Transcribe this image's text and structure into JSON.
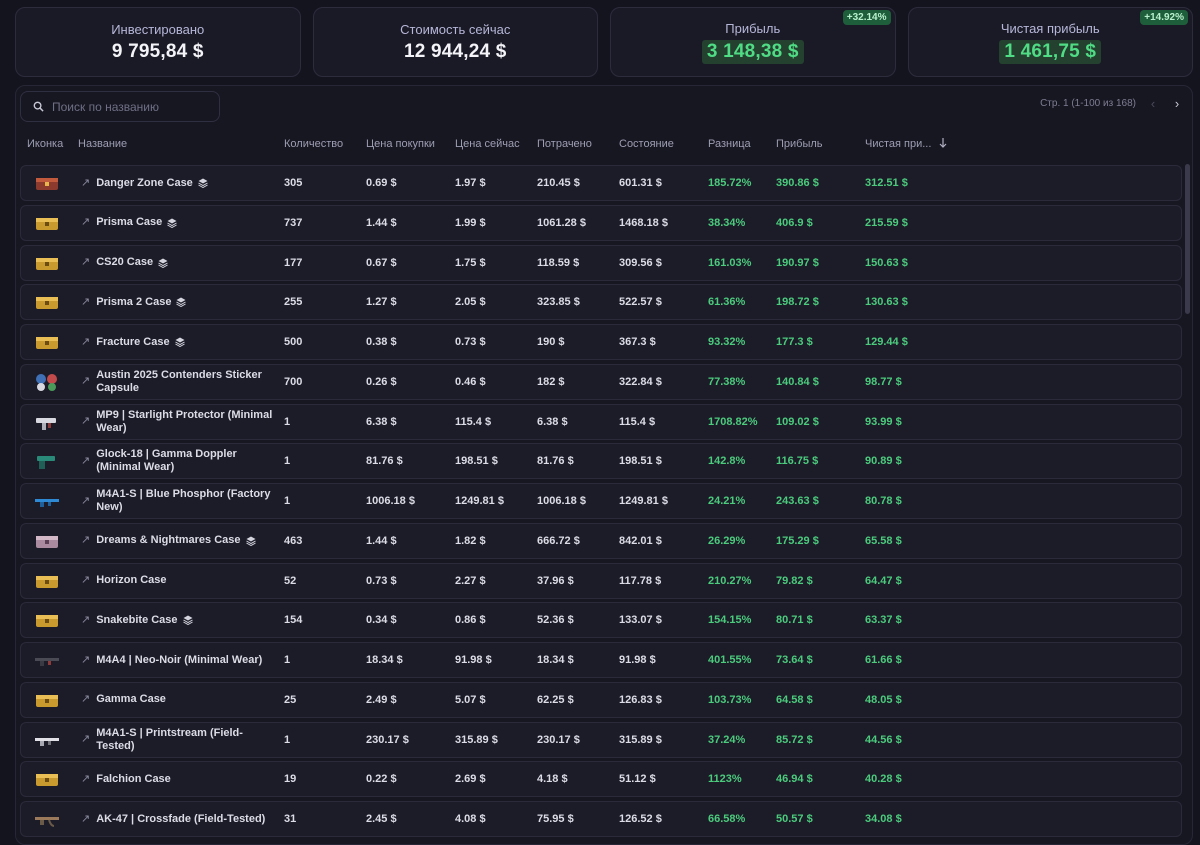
{
  "summary": [
    {
      "label": "Инвестировано",
      "value": "9 795,84 $",
      "badge": null,
      "highlight": false
    },
    {
      "label": "Стоимость сейчас",
      "value": "12 944,24 $",
      "badge": null,
      "highlight": false
    },
    {
      "label": "Прибыль",
      "value": "3 148,38 $",
      "badge": "+32.14%",
      "highlight": true
    },
    {
      "label": "Чистая прибыль",
      "value": "1 461,75 $",
      "badge": "+14.92%",
      "highlight": true
    }
  ],
  "search": {
    "placeholder": "Поиск по названию"
  },
  "pagination": {
    "text": "Стр. 1 (1-100 из 168)"
  },
  "columns": [
    "Иконка",
    "Название",
    "Количество",
    "Цена покупки",
    "Цена сейчас",
    "Потрачено",
    "Состояние",
    "Разница",
    "Прибыль",
    "Чистая при..."
  ],
  "colors": {
    "positive": "#4bcb7c",
    "case_gold": "#d6a93a",
    "background": "#14141f"
  },
  "rows": [
    {
      "name": "Danger Zone Case",
      "stack": true,
      "icon": "case-red-icon",
      "qty": "305",
      "buy": "0.69 $",
      "now": "1.97 $",
      "spent": "210.45 $",
      "value": "601.31 $",
      "diff": "185.72%",
      "profit": "390.86 $",
      "net": "312.51 $"
    },
    {
      "name": "Prisma Case",
      "stack": true,
      "icon": "case-gold-icon",
      "qty": "737",
      "buy": "1.44 $",
      "now": "1.99 $",
      "spent": "1061.28 $",
      "value": "1468.18 $",
      "diff": "38.34%",
      "profit": "406.9 $",
      "net": "215.59 $"
    },
    {
      "name": "CS20 Case",
      "stack": true,
      "icon": "case-gold-icon",
      "qty": "177",
      "buy": "0.67 $",
      "now": "1.75 $",
      "spent": "118.59 $",
      "value": "309.56 $",
      "diff": "161.03%",
      "profit": "190.97 $",
      "net": "150.63 $"
    },
    {
      "name": "Prisma 2 Case",
      "stack": true,
      "icon": "case-gold-icon",
      "qty": "255",
      "buy": "1.27 $",
      "now": "2.05 $",
      "spent": "323.85 $",
      "value": "522.57 $",
      "diff": "61.36%",
      "profit": "198.72 $",
      "net": "130.63 $"
    },
    {
      "name": "Fracture Case",
      "stack": true,
      "icon": "case-gold-icon",
      "qty": "500",
      "buy": "0.38 $",
      "now": "0.73 $",
      "spent": "190 $",
      "value": "367.3 $",
      "diff": "93.32%",
      "profit": "177.3 $",
      "net": "129.44 $"
    },
    {
      "name": "Austin 2025 Contenders Sticker Capsule",
      "stack": false,
      "icon": "sticker-capsule-icon",
      "qty": "700",
      "buy": "0.26 $",
      "now": "0.46 $",
      "spent": "182 $",
      "value": "322.84 $",
      "diff": "77.38%",
      "profit": "140.84 $",
      "net": "98.77 $"
    },
    {
      "name": "MP9 | Starlight Protector (Minimal Wear)",
      "stack": false,
      "icon": "smg-icon",
      "qty": "1",
      "buy": "6.38 $",
      "now": "115.4 $",
      "spent": "6.38 $",
      "value": "115.4 $",
      "diff": "1708.82%",
      "profit": "109.02 $",
      "net": "93.99 $"
    },
    {
      "name": "Glock-18 | Gamma Doppler (Minimal Wear)",
      "stack": false,
      "icon": "pistol-icon",
      "qty": "1",
      "buy": "81.76 $",
      "now": "198.51 $",
      "spent": "81.76 $",
      "value": "198.51 $",
      "diff": "142.8%",
      "profit": "116.75 $",
      "net": "90.89 $"
    },
    {
      "name": "M4A1-S | Blue Phosphor (Factory New)",
      "stack": false,
      "icon": "rifle-blue-icon",
      "qty": "1",
      "buy": "1006.18 $",
      "now": "1249.81 $",
      "spent": "1006.18 $",
      "value": "1249.81 $",
      "diff": "24.21%",
      "profit": "243.63 $",
      "net": "80.78 $"
    },
    {
      "name": "Dreams & Nightmares Case",
      "stack": true,
      "icon": "case-pink-icon",
      "qty": "463",
      "buy": "1.44 $",
      "now": "1.82 $",
      "spent": "666.72 $",
      "value": "842.01 $",
      "diff": "26.29%",
      "profit": "175.29 $",
      "net": "65.58 $"
    },
    {
      "name": "Horizon Case",
      "stack": false,
      "icon": "case-gold-icon",
      "qty": "52",
      "buy": "0.73 $",
      "now": "2.27 $",
      "spent": "37.96 $",
      "value": "117.78 $",
      "diff": "210.27%",
      "profit": "79.82 $",
      "net": "64.47 $"
    },
    {
      "name": "Snakebite Case",
      "stack": true,
      "icon": "case-gold-icon",
      "qty": "154",
      "buy": "0.34 $",
      "now": "0.86 $",
      "spent": "52.36 $",
      "value": "133.07 $",
      "diff": "154.15%",
      "profit": "80.71 $",
      "net": "63.37 $"
    },
    {
      "name": "M4A4 | Neo-Noir (Minimal Wear)",
      "stack": false,
      "icon": "rifle-dark-icon",
      "qty": "1",
      "buy": "18.34 $",
      "now": "91.98 $",
      "spent": "18.34 $",
      "value": "91.98 $",
      "diff": "401.55%",
      "profit": "73.64 $",
      "net": "61.66 $"
    },
    {
      "name": "Gamma Case",
      "stack": false,
      "icon": "case-gold-icon",
      "qty": "25",
      "buy": "2.49 $",
      "now": "5.07 $",
      "spent": "62.25 $",
      "value": "126.83 $",
      "diff": "103.73%",
      "profit": "64.58 $",
      "net": "48.05 $"
    },
    {
      "name": "M4A1-S | Printstream (Field-Tested)",
      "stack": false,
      "icon": "rifle-white-icon",
      "qty": "1",
      "buy": "230.17 $",
      "now": "315.89 $",
      "spent": "230.17 $",
      "value": "315.89 $",
      "diff": "37.24%",
      "profit": "85.72 $",
      "net": "44.56 $"
    },
    {
      "name": "Falchion Case",
      "stack": false,
      "icon": "case-gold-icon",
      "qty": "19",
      "buy": "0.22 $",
      "now": "2.69 $",
      "spent": "4.18 $",
      "value": "51.12 $",
      "diff": "1123%",
      "profit": "46.94 $",
      "net": "40.28 $"
    },
    {
      "name": "AK-47 | Crossfade (Field-Tested)",
      "stack": false,
      "icon": "rifle-ak-icon",
      "qty": "31",
      "buy": "2.45 $",
      "now": "4.08 $",
      "spent": "75.95 $",
      "value": "126.52 $",
      "diff": "66.58%",
      "profit": "50.57 $",
      "net": "34.08 $"
    }
  ]
}
